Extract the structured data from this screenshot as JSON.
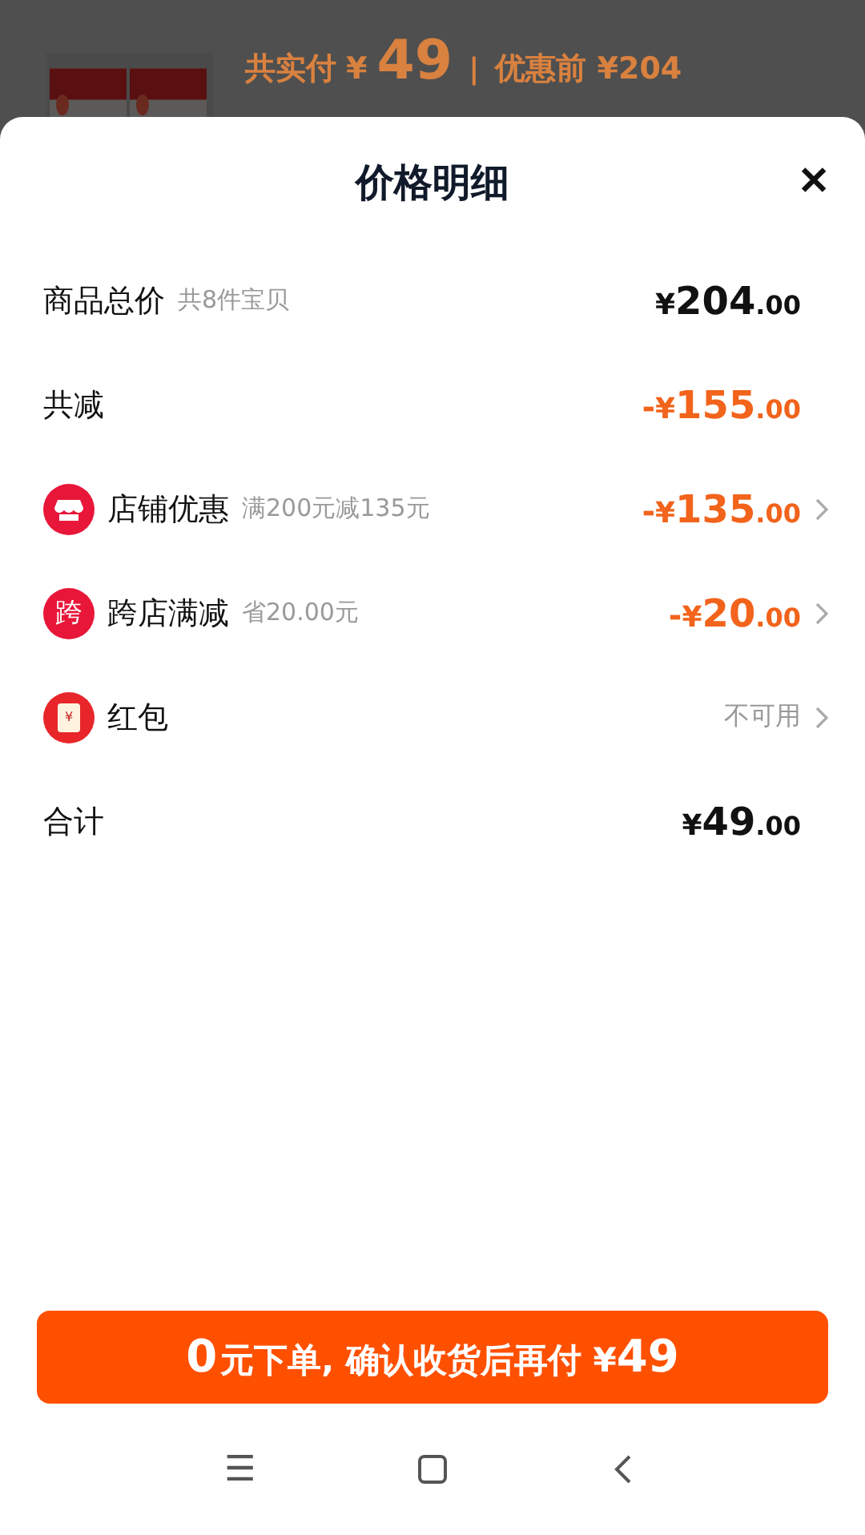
{
  "backdrop": {
    "paid_label": "共实付",
    "currency": "¥",
    "paid_amount": "49",
    "separator": "|",
    "before_label": "优惠前",
    "before_amount": "¥204"
  },
  "sheet": {
    "title": "价格明细",
    "close": "✕",
    "rows": [
      {
        "kind": "plain",
        "label": "商品总价",
        "note": "共8件宝贝",
        "amount": {
          "currency": "¥",
          "int": "204",
          "dec": ".00"
        },
        "discount": false,
        "chevron": false
      },
      {
        "kind": "plain",
        "label": "共减",
        "amount": {
          "sign": "-",
          "currency": "¥",
          "int": "155",
          "dec": ".00"
        },
        "discount": true,
        "chevron": false
      },
      {
        "kind": "icon",
        "icon": {
          "kind": "store"
        },
        "label": "店铺优惠",
        "note": "满200元减135元",
        "amount": {
          "sign": "-",
          "currency": "¥",
          "int": "135",
          "dec": ".00"
        },
        "discount": true,
        "chevron": true
      },
      {
        "kind": "icon",
        "icon": {
          "kind": "badge",
          "text": "跨"
        },
        "label": "跨店满减",
        "note": "省20.00元",
        "amount": {
          "sign": "-",
          "currency": "¥",
          "int": "20",
          "dec": ".00"
        },
        "discount": true,
        "chevron": true
      },
      {
        "kind": "icon",
        "icon": {
          "kind": "packet",
          "text": "¥"
        },
        "label": "红包",
        "status": "不可用",
        "chevron": true
      },
      {
        "kind": "plain",
        "label": "合计",
        "amount": {
          "currency": "¥",
          "int": "49",
          "dec": ".00"
        },
        "discount": false,
        "chevron": false
      }
    ],
    "button": {
      "lead": "0",
      "text": "元下单, 确认收货后再付 ¥",
      "amount": "49"
    }
  },
  "nav": [
    "☰"
  ]
}
